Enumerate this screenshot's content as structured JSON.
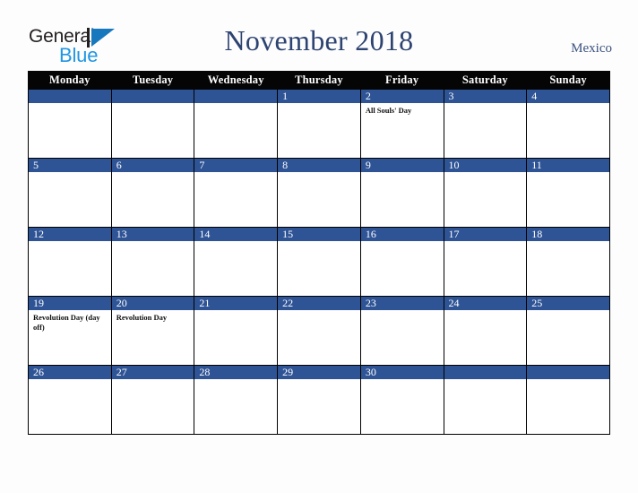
{
  "brand": {
    "name_part1": "General",
    "name_part2": "Blue",
    "mark_icon": "triangle-flag-icon",
    "colors": {
      "dark": "#231f20",
      "mark_blue": "#1878be",
      "text_blue": "#2196e3"
    }
  },
  "header": {
    "title": "November 2018",
    "country": "Mexico",
    "title_color": "#2d4371"
  },
  "calendar": {
    "month": "November",
    "year": "2018",
    "weekday_headers": [
      "Monday",
      "Tuesday",
      "Wednesday",
      "Thursday",
      "Friday",
      "Saturday",
      "Sunday"
    ],
    "colors": {
      "header_bg": "#050505",
      "header_text": "#ffffff",
      "daybar_bg": "#2f5496",
      "daybar_text": "#ffffff",
      "cell_bg": "#ffffff",
      "border": "#000000"
    },
    "weeks": [
      [
        {
          "date": "",
          "events": []
        },
        {
          "date": "",
          "events": []
        },
        {
          "date": "",
          "events": []
        },
        {
          "date": "1",
          "events": []
        },
        {
          "date": "2",
          "events": [
            "All Souls' Day"
          ]
        },
        {
          "date": "3",
          "events": []
        },
        {
          "date": "4",
          "events": []
        }
      ],
      [
        {
          "date": "5",
          "events": []
        },
        {
          "date": "6",
          "events": []
        },
        {
          "date": "7",
          "events": []
        },
        {
          "date": "8",
          "events": []
        },
        {
          "date": "9",
          "events": []
        },
        {
          "date": "10",
          "events": []
        },
        {
          "date": "11",
          "events": []
        }
      ],
      [
        {
          "date": "12",
          "events": []
        },
        {
          "date": "13",
          "events": []
        },
        {
          "date": "14",
          "events": []
        },
        {
          "date": "15",
          "events": []
        },
        {
          "date": "16",
          "events": []
        },
        {
          "date": "17",
          "events": []
        },
        {
          "date": "18",
          "events": []
        }
      ],
      [
        {
          "date": "19",
          "events": [
            "Revolution Day (day off)"
          ]
        },
        {
          "date": "20",
          "events": [
            "Revolution Day"
          ]
        },
        {
          "date": "21",
          "events": []
        },
        {
          "date": "22",
          "events": []
        },
        {
          "date": "23",
          "events": []
        },
        {
          "date": "24",
          "events": []
        },
        {
          "date": "25",
          "events": []
        }
      ],
      [
        {
          "date": "26",
          "events": []
        },
        {
          "date": "27",
          "events": []
        },
        {
          "date": "28",
          "events": []
        },
        {
          "date": "29",
          "events": []
        },
        {
          "date": "30",
          "events": []
        },
        {
          "date": "",
          "events": []
        },
        {
          "date": "",
          "events": []
        }
      ]
    ]
  }
}
